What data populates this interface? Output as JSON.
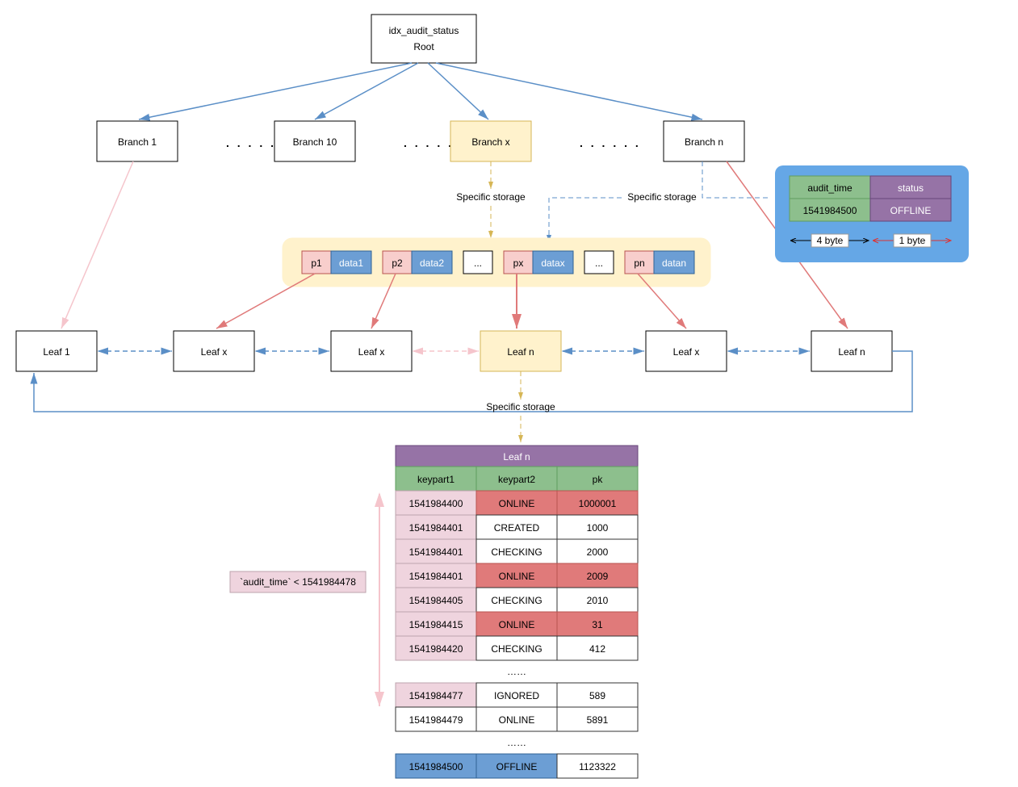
{
  "root": {
    "line1": "idx_audit_status",
    "line2": "Root"
  },
  "branches": {
    "b1": "Branch 1",
    "b10": "Branch 10",
    "bx": "Branch x",
    "bn": "Branch n"
  },
  "labels": {
    "specific_storage": "Specific storage",
    "ellipsis_big": ". . . . . .",
    "dots": "...",
    "dots_row": "……"
  },
  "storage_cells": {
    "p1": "p1",
    "d1": "data1",
    "p2": "p2",
    "d2": "data2",
    "px": "px",
    "dx": "datax",
    "pn": "pn",
    "dn": "datan"
  },
  "leaves": {
    "l1": "Leaf 1",
    "lx": "Leaf x",
    "ln": "Leaf n"
  },
  "legend": {
    "h1": "audit_time",
    "h2": "status",
    "v1": "1541984500",
    "v2": "OFFLINE",
    "b4": "4 byte",
    "b1": "1 byte"
  },
  "table": {
    "title": "Leaf n",
    "h1": "keypart1",
    "h2": "keypart2",
    "h3": "pk",
    "rows": [
      {
        "k1": "1541984400",
        "k2": "ONLINE",
        "pk": "1000001",
        "hl": true
      },
      {
        "k1": "1541984401",
        "k2": "CREATED",
        "pk": "1000",
        "hl": false
      },
      {
        "k1": "1541984401",
        "k2": "CHECKING",
        "pk": "2000",
        "hl": false
      },
      {
        "k1": "1541984401",
        "k2": "ONLINE",
        "pk": "2009",
        "hl": true
      },
      {
        "k1": "1541984405",
        "k2": "CHECKING",
        "pk": "2010",
        "hl": false
      },
      {
        "k1": "1541984415",
        "k2": "ONLINE",
        "pk": "31",
        "hl": true
      },
      {
        "k1": "1541984420",
        "k2": "CHECKING",
        "pk": "412",
        "hl": false
      }
    ],
    "rows2": [
      {
        "k1": "1541984477",
        "k2": "IGNORED",
        "pk": "589",
        "hl": false,
        "pink": true
      },
      {
        "k1": "1541984479",
        "k2": "ONLINE",
        "pk": "5891",
        "hl": false,
        "pink": false
      }
    ],
    "last": {
      "k1": "1541984500",
      "k2": "OFFLINE",
      "pk": "1123322"
    }
  },
  "annotation": "`audit_time` < 1541984478"
}
